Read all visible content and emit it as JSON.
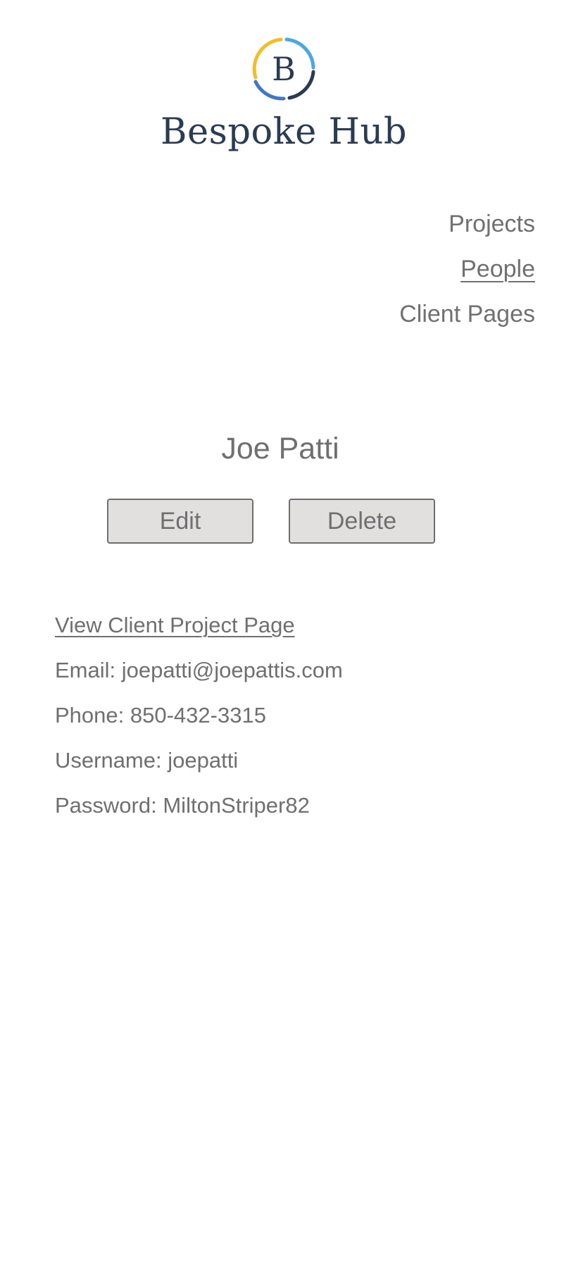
{
  "brand": {
    "logo_letter": "B",
    "name": "Bespoke Hub",
    "colors": {
      "navy": "#2b3b52",
      "yellow": "#f2bc2e",
      "light_blue": "#4aa8e0",
      "blue": "#3f77c9"
    }
  },
  "nav": {
    "items": [
      {
        "label": "Projects",
        "active": false
      },
      {
        "label": "People",
        "active": true
      },
      {
        "label": "Client Pages",
        "active": false
      }
    ]
  },
  "person": {
    "name": "Joe Patti",
    "edit_label": "Edit",
    "delete_label": "Delete",
    "client_page_link": "View Client Project Page",
    "email_label": "Email:",
    "email": "joepatti@joepattis.com",
    "phone_label": "Phone:",
    "phone": "850-432-3315",
    "username_label": "Username:",
    "username": "joepatti",
    "password_label": "Password:",
    "password": "MiltonStriper82"
  }
}
